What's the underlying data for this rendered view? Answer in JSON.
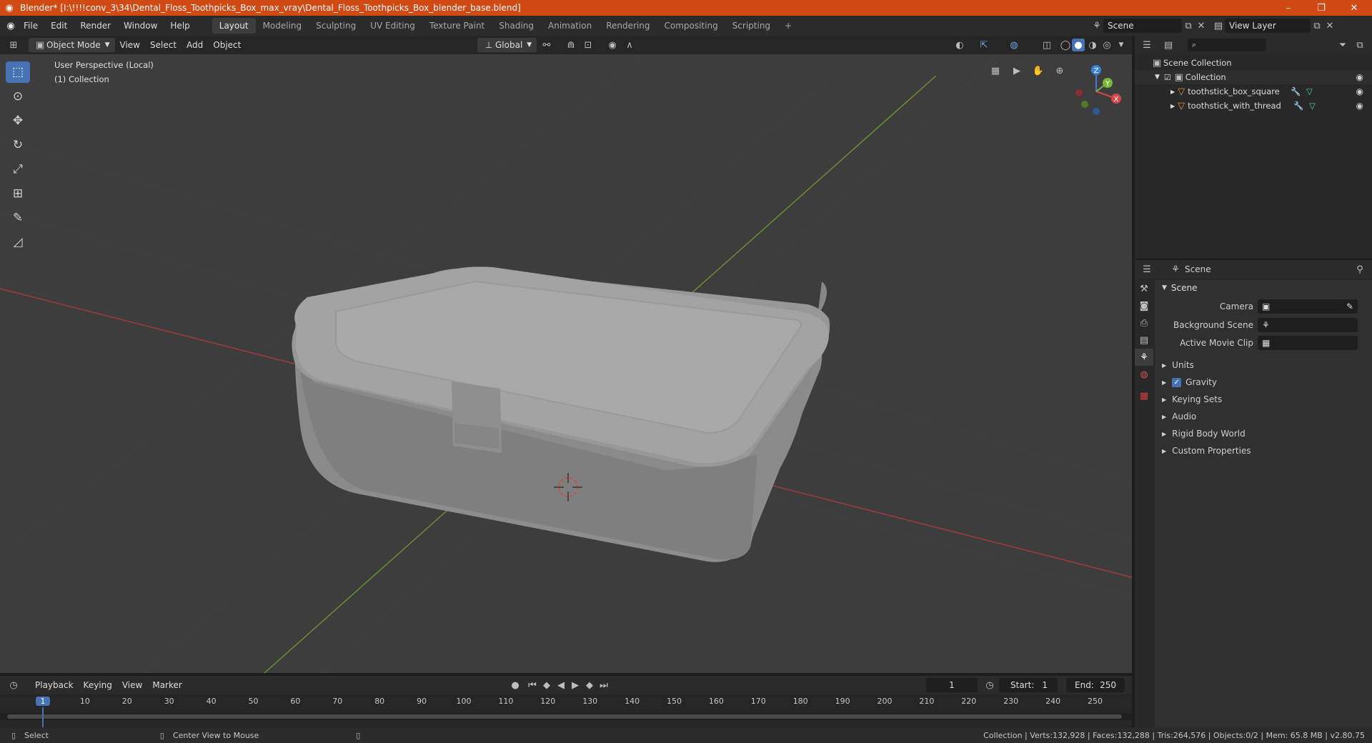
{
  "window": {
    "title": "Blender* [I:\\!!!!conv_3\\34\\Dental_Floss_Toothpicks_Box_max_vray\\Dental_Floss_Toothpicks_Box_blender_base.blend]",
    "minimize": "–",
    "maximize": "❐",
    "close": "✕"
  },
  "menu": [
    "File",
    "Edit",
    "Render",
    "Window",
    "Help"
  ],
  "workspaces": [
    "Layout",
    "Modeling",
    "Sculpting",
    "UV Editing",
    "Texture Paint",
    "Shading",
    "Animation",
    "Rendering",
    "Compositing",
    "Scripting"
  ],
  "workspace_add": "+",
  "scene_field": "Scene",
  "view_layer_field": "View Layer",
  "viewport_header": {
    "mode": "Object Mode",
    "menus": [
      "View",
      "Select",
      "Add",
      "Object"
    ],
    "transform_orientation": "Global"
  },
  "viewport": {
    "perspective_label": "User Perspective (Local)",
    "collection_label": "(1) Collection",
    "gizmo": {
      "x": "X",
      "y": "Y",
      "z": "Z"
    }
  },
  "outliner": {
    "search_placeholder": "",
    "root": "Scene Collection",
    "collection": "Collection",
    "objects": [
      "toothstick_box_square",
      "toothstick_with_thread"
    ]
  },
  "properties": {
    "header": "Scene",
    "section": "Scene",
    "fields": [
      {
        "label": "Camera",
        "value": ""
      },
      {
        "label": "Background Scene",
        "value": ""
      },
      {
        "label": "Active Movie Clip",
        "value": ""
      }
    ],
    "panels": [
      "Units",
      "Gravity",
      "Keying Sets",
      "Audio",
      "Rigid Body World",
      "Custom Properties"
    ],
    "gravity_checked": true
  },
  "timeline": {
    "menus": [
      "Playback",
      "Keying",
      "View",
      "Marker"
    ],
    "current_frame": "1",
    "start_label": "Start:",
    "start": "1",
    "end_label": "End:",
    "end": "250",
    "ticks": [
      "1",
      "10",
      "20",
      "30",
      "40",
      "50",
      "60",
      "70",
      "80",
      "90",
      "100",
      "110",
      "120",
      "130",
      "140",
      "150",
      "160",
      "170",
      "180",
      "190",
      "200",
      "210",
      "220",
      "230",
      "240",
      "250"
    ]
  },
  "statusbar": {
    "select": "Select",
    "center_view": "Center View to Mouse",
    "stats": "Collection | Verts:132,928 | Faces:132,288 | Tris:264,576 | Objects:0/2 | Mem: 65.8 MB | v2.80.75"
  },
  "colors": {
    "titlebar": "#d24a13",
    "accent": "#4772b3",
    "x_axis": "#d8464b",
    "y_axis": "#78b63a",
    "z_axis": "#3d82d8"
  }
}
